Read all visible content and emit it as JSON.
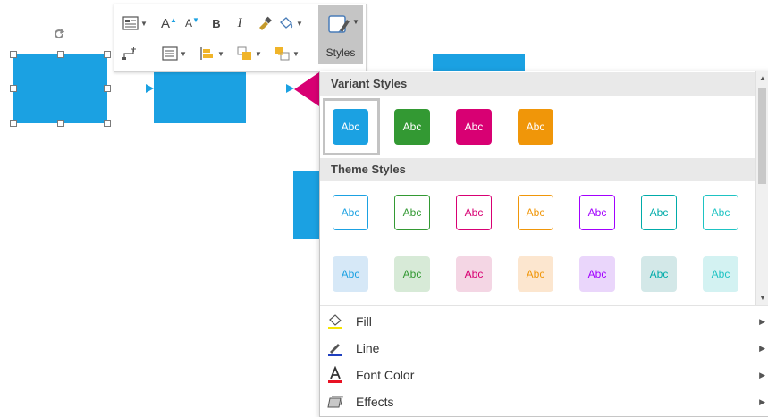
{
  "toolbar": {
    "bold": "B",
    "italic": "I",
    "grow_font": "A",
    "shrink_font": "A",
    "styles_label": "Styles"
  },
  "gallery": {
    "variant_header": "Variant Styles",
    "theme_header": "Theme Styles",
    "swatch_text": "Abc",
    "variant": [
      {
        "fill": "#1ba1e2",
        "text": "#ffffff",
        "border": "#1ba1e2",
        "selected": true
      },
      {
        "fill": "#339933",
        "text": "#ffffff",
        "border": "#339933",
        "selected": false
      },
      {
        "fill": "#d80073",
        "text": "#ffffff",
        "border": "#d80073",
        "selected": false
      },
      {
        "fill": "#f09609",
        "text": "#ffffff",
        "border": "#f09609",
        "selected": false
      }
    ],
    "theme_outline": [
      {
        "fill": "#ffffff",
        "text": "#1ba1e2",
        "border": "#1ba1e2"
      },
      {
        "fill": "#ffffff",
        "text": "#339933",
        "border": "#339933"
      },
      {
        "fill": "#ffffff",
        "text": "#d80073",
        "border": "#d80073"
      },
      {
        "fill": "#ffffff",
        "text": "#f09609",
        "border": "#f09609"
      },
      {
        "fill": "#ffffff",
        "text": "#a200ff",
        "border": "#a200ff"
      },
      {
        "fill": "#ffffff",
        "text": "#00aba9",
        "border": "#00aba9"
      },
      {
        "fill": "#ffffff",
        "text": "#1ec3c3",
        "border": "#1ec3c3"
      }
    ],
    "theme_light": [
      {
        "fill": "#d6e8f7",
        "text": "#1ba1e2",
        "border": "#d6e8f7"
      },
      {
        "fill": "#d7ead7",
        "text": "#339933",
        "border": "#d7ead7"
      },
      {
        "fill": "#f4d6e4",
        "text": "#d80073",
        "border": "#f4d6e4"
      },
      {
        "fill": "#fce6cf",
        "text": "#f09609",
        "border": "#fce6cf"
      },
      {
        "fill": "#ead6fb",
        "text": "#a200ff",
        "border": "#ead6fb"
      },
      {
        "fill": "#d3e8e8",
        "text": "#00aba9",
        "border": "#d3e8e8"
      },
      {
        "fill": "#d3f2f2",
        "text": "#1ec3c3",
        "border": "#d3f2f2"
      }
    ]
  },
  "menu": {
    "fill": "Fill",
    "line": "Line",
    "font_color": "Font Color",
    "effects": "Effects"
  },
  "colors": {
    "shape": "#1ba1e2",
    "selected_shape_accent": "#d80073",
    "styles_button_bg": "#c5c5c5"
  }
}
